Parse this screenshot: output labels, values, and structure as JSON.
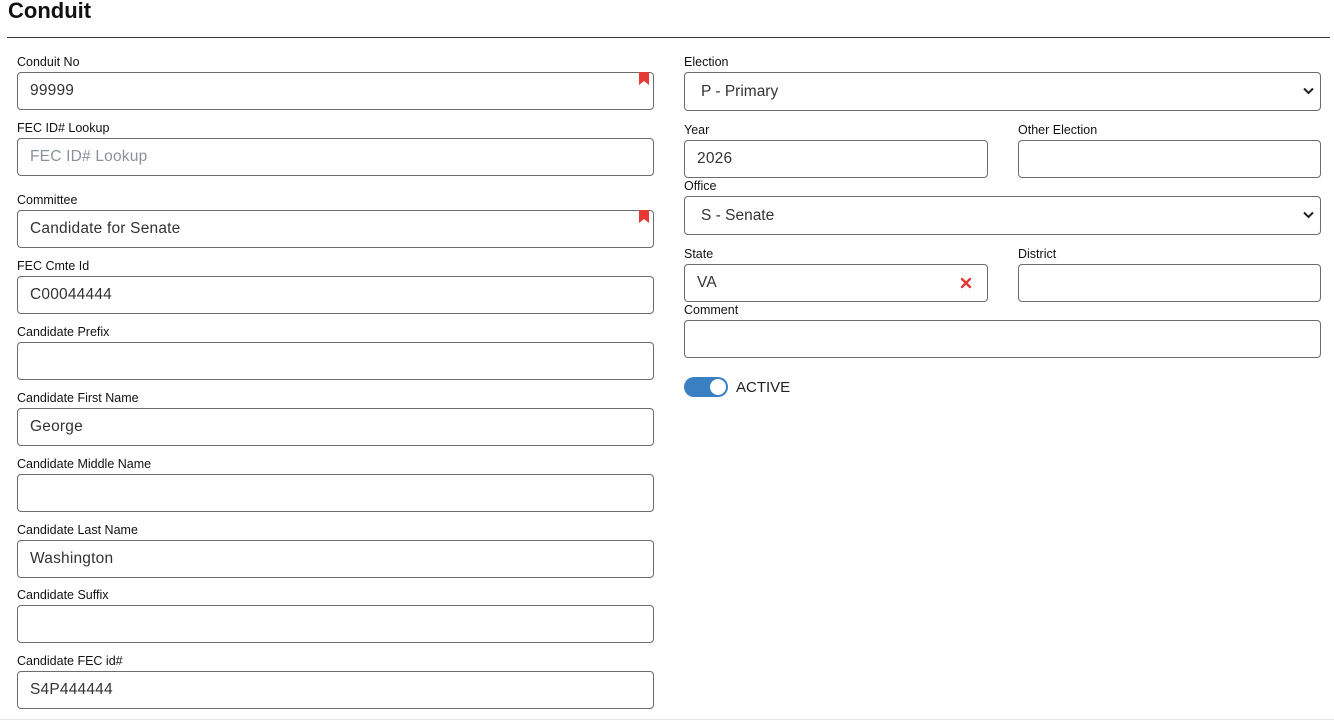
{
  "page": {
    "title": "Conduit"
  },
  "left": [
    {
      "key": "conduit_no",
      "label": "Conduit No",
      "value": "99999",
      "placeholder": "",
      "required": true
    },
    {
      "key": "fec_lookup",
      "label": "FEC ID# Lookup",
      "value": "",
      "placeholder": "FEC ID# Lookup",
      "required": false
    },
    {
      "key": "committee",
      "label": "Committee",
      "value": "Candidate for Senate",
      "placeholder": "",
      "required": true
    },
    {
      "key": "fec_cmte_id",
      "label": "FEC Cmte Id",
      "value": "C00044444",
      "placeholder": "",
      "required": false
    },
    {
      "key": "cand_prefix",
      "label": "Candidate Prefix",
      "value": "",
      "placeholder": "",
      "required": false
    },
    {
      "key": "cand_first",
      "label": "Candidate First Name",
      "value": "George",
      "placeholder": "",
      "required": false
    },
    {
      "key": "cand_middle",
      "label": "Candidate Middle Name",
      "value": "",
      "placeholder": "",
      "required": false
    },
    {
      "key": "cand_last",
      "label": "Candidate Last Name",
      "value": "Washington",
      "placeholder": "",
      "required": false
    },
    {
      "key": "cand_suffix",
      "label": "Candidate Suffix",
      "value": "",
      "placeholder": "",
      "required": false
    },
    {
      "key": "cand_fec_id",
      "label": "Candidate FEC id#",
      "value": "S4P444444",
      "placeholder": "",
      "required": false
    }
  ],
  "right": {
    "election": {
      "label": "Election",
      "value": "P - Primary"
    },
    "year": {
      "label": "Year",
      "value": "2026"
    },
    "other_election": {
      "label": "Other Election",
      "value": ""
    },
    "office": {
      "label": "Office",
      "value": "S - Senate"
    },
    "state": {
      "label": "State",
      "value": "VA"
    },
    "district": {
      "label": "District",
      "value": ""
    },
    "comment": {
      "label": "Comment",
      "value": ""
    },
    "active": {
      "label": "ACTIVE",
      "on": true
    }
  },
  "colors": {
    "required_marker": "#e53935",
    "toggle_on": "#3a7fc1",
    "clear_icon": "#e53935"
  },
  "icons": {
    "required": "bookmark-icon",
    "select": "chevron-down-icon",
    "clear": "close-icon"
  }
}
